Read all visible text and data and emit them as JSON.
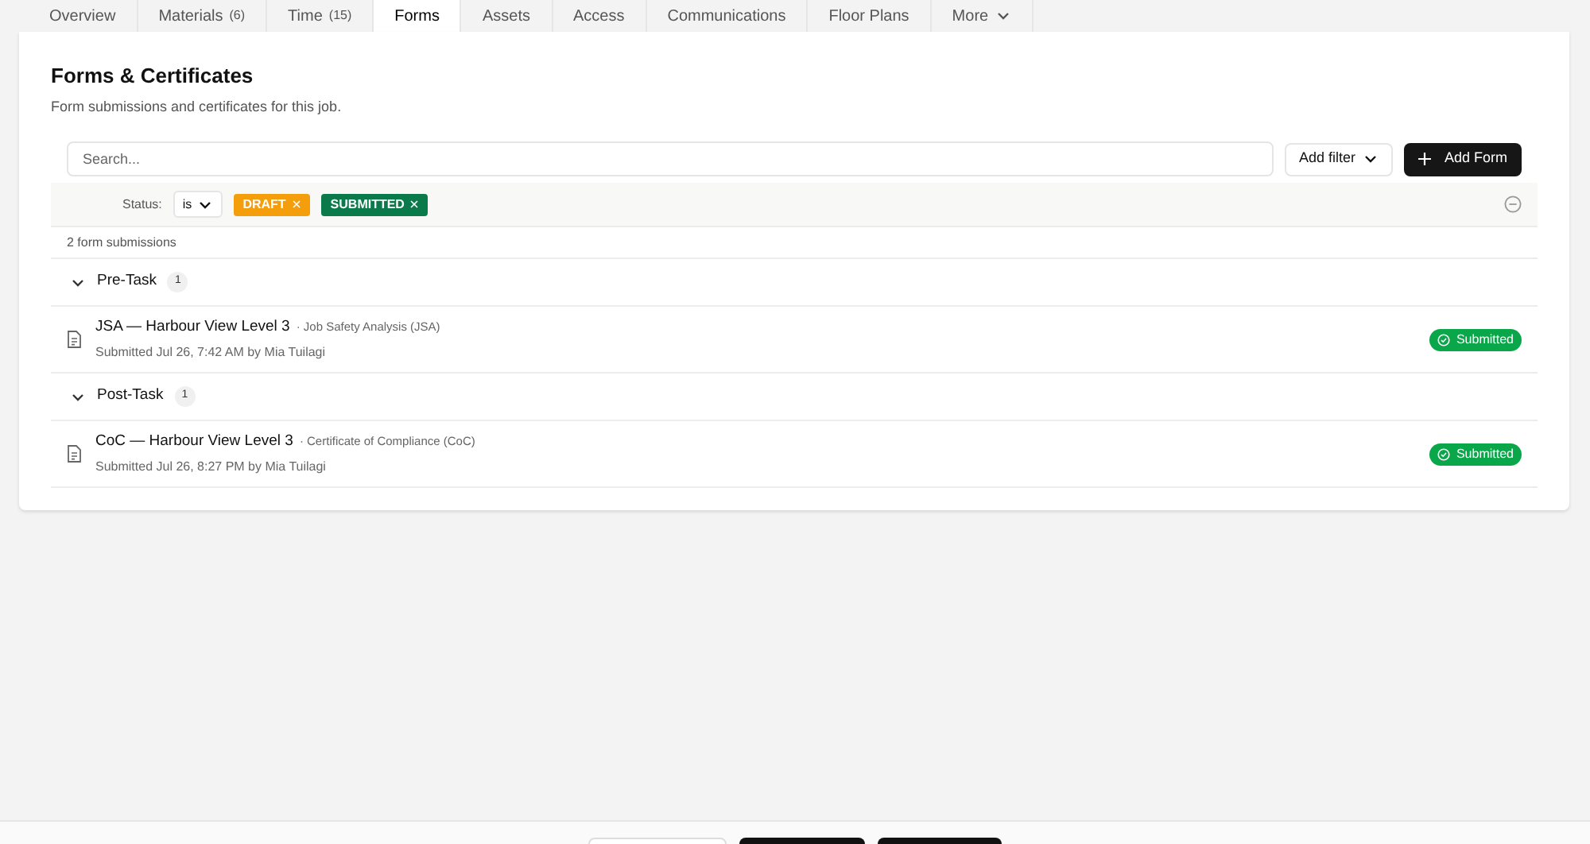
{
  "tabs": [
    {
      "label": "Overview",
      "selected": false
    },
    {
      "label": "Materials",
      "count": "(6)",
      "selected": false
    },
    {
      "label": "Time",
      "count": "(15)",
      "selected": false
    },
    {
      "label": "Forms",
      "selected": true
    },
    {
      "label": "Assets",
      "selected": false
    },
    {
      "label": "Access",
      "selected": false
    },
    {
      "label": "Communications",
      "selected": false
    },
    {
      "label": "Floor Plans",
      "selected": false
    },
    {
      "label": "More",
      "dropdown": true,
      "selected": false
    }
  ],
  "header": {
    "title": "Forms & Certificates",
    "subtitle": "Form submissions and certificates for this job."
  },
  "search": {
    "placeholder": "Search..."
  },
  "add_filter": "Add filter",
  "add_form": "Add Form",
  "filter": {
    "label": "Status:",
    "operator": "is",
    "chips": [
      {
        "label": "DRAFT",
        "color": "#f59e0b"
      },
      {
        "label": "SUBMITTED",
        "color": "#0b7a4b"
      }
    ]
  },
  "count": "2 form submissions",
  "groups": [
    {
      "name": "Pre-Task",
      "count": "1",
      "expanded": true,
      "items": [
        {
          "title": "JSA — Harbour View Level 3",
          "type": "· Job Safety Analysis (JSA)",
          "meta": "Submitted Jul 26, 7:42 AM by Mia Tuilagi",
          "status": "Submitted"
        }
      ]
    },
    {
      "name": "Post-Task",
      "count": "1",
      "expanded": true,
      "items": [
        {
          "title": "CoC — Harbour View Level 3",
          "type": "· Certificate of Compliance (CoC)",
          "meta": "Submitted Jul 26, 8:27 PM by Mia Tuilagi",
          "status": "Submitted"
        }
      ]
    }
  ]
}
